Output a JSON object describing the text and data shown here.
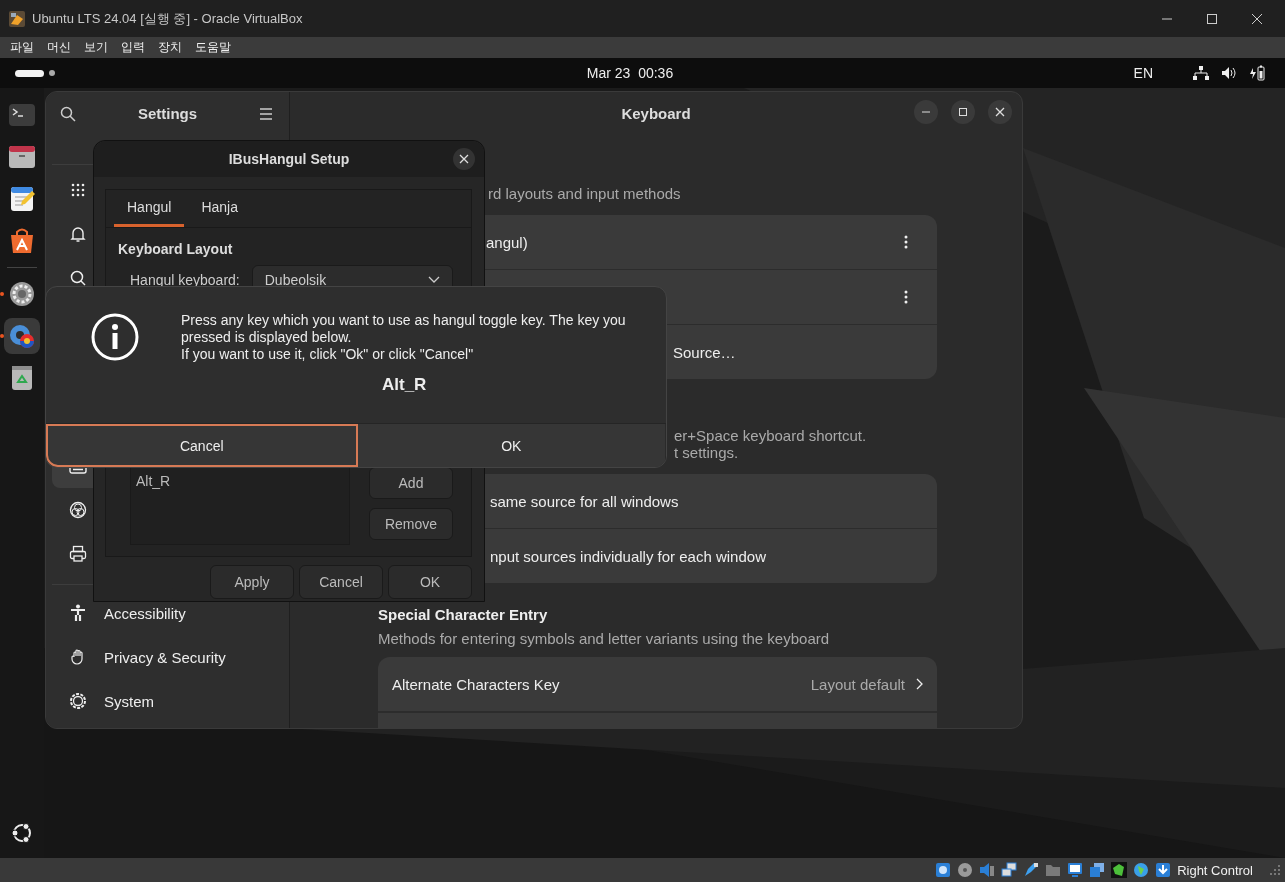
{
  "vbox": {
    "title": "Ubuntu LTS 24.04 [실행 중] - Oracle VirtualBox",
    "menu": [
      "파일",
      "머신",
      "보기",
      "입력",
      "장치",
      "도움말"
    ],
    "status": "Right Control"
  },
  "topbar": {
    "clock": "Mar 23  00:36",
    "input_source": "EN"
  },
  "dock": {
    "apps": [
      {
        "running": false,
        "focused": false
      },
      {
        "running": false,
        "focused": false
      },
      {
        "running": false,
        "focused": false
      },
      {
        "running": false,
        "focused": false
      },
      {
        "running": true,
        "focused": false
      },
      {
        "running": true,
        "focused": true
      },
      {
        "running": false,
        "focused": false
      }
    ]
  },
  "settings": {
    "sidebar_title": "Settings",
    "items": [
      {
        "selected": false
      },
      {
        "selected": false
      },
      {
        "selected": false
      },
      {
        "selected": true
      },
      {
        "selected": false
      },
      {
        "selected": false
      },
      {
        "label": "Accessibility",
        "selected": false
      },
      {
        "label": "Privacy & Security",
        "selected": false
      },
      {
        "label": "System",
        "selected": false
      }
    ],
    "page_title": "Keyboard",
    "intro": "rd layouts and input methods",
    "sources": [
      {
        "kind": "source",
        "label": "angul)"
      },
      {
        "kind": "source"
      },
      {
        "kind": "add",
        "label": "Source…"
      }
    ],
    "switch_note": [
      "er+Space keyboard shortcut.",
      "t settings."
    ],
    "switch_options": [
      "same source for all windows",
      "nput sources individually for each window"
    ],
    "special": {
      "title": "Special Character Entry",
      "subtitle": "Methods for entering symbols and letter variants using the keyboard",
      "rows": [
        {
          "label": "Alternate Characters Key",
          "value": "Layout default"
        }
      ]
    }
  },
  "ibus": {
    "title": "IBusHangul Setup",
    "tabs": [
      {
        "label": "Hangul",
        "selected": true
      },
      {
        "label": "Hanja",
        "selected": false
      }
    ],
    "section": "Keyboard Layout",
    "keyboard_label": "Hangul keyboard:",
    "keyboard_value": "Dubeolsik",
    "toggle_keys": [
      "Alt_R"
    ],
    "list_buttons": [
      "Add",
      "Remove"
    ],
    "buttons": [
      "Apply",
      "Cancel",
      "OK"
    ]
  },
  "alert": {
    "message": "Press any key which you want to use as hangul toggle key. The key you\npressed is displayed below.\nIf you want to use it, click \"Ok\" or click \"Cancel\"",
    "key": "Alt_R",
    "buttons": [
      {
        "label": "Cancel",
        "focused": true
      },
      {
        "label": "OK",
        "focused": false
      }
    ]
  }
}
